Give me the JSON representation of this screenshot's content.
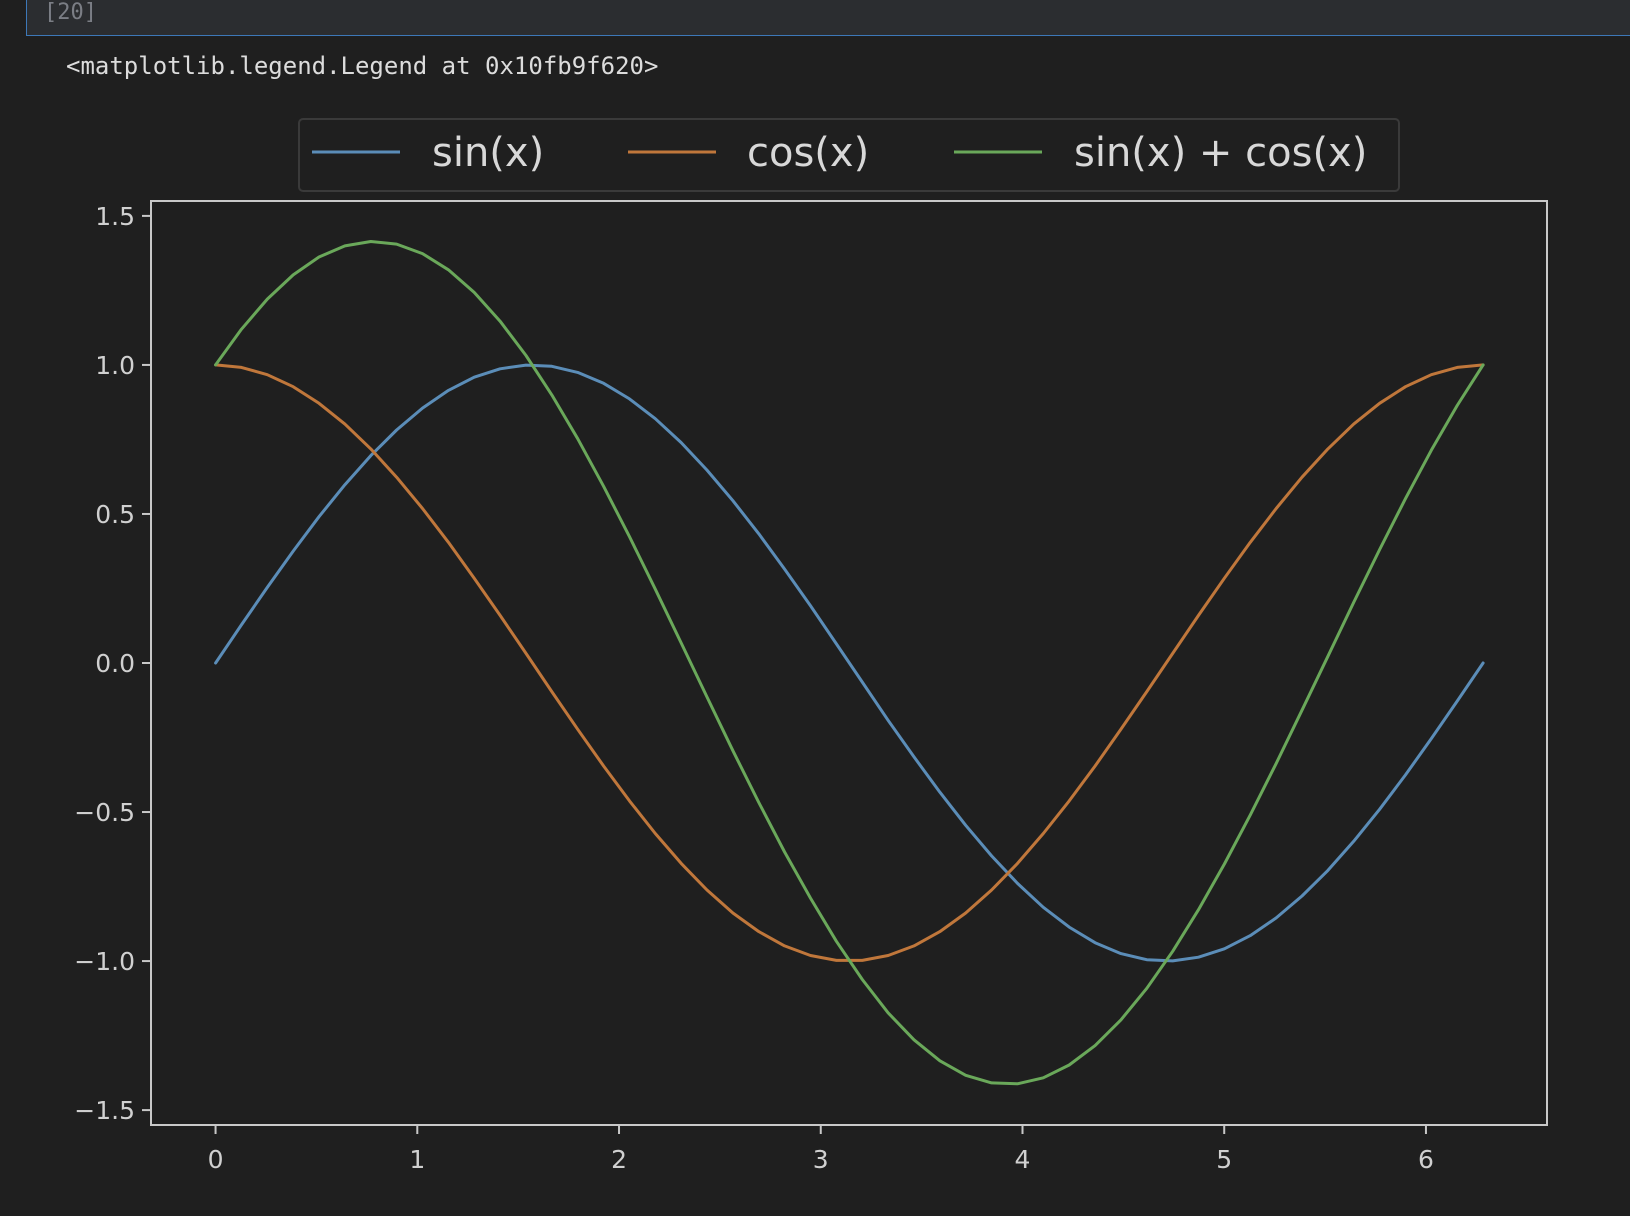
{
  "cell": {
    "execution_count": "[20]",
    "output_text": "<matplotlib.legend.Legend at 0x10fb9f620>"
  },
  "colors": {
    "background": "#1f1f1f",
    "axes_frame": "#c8c8c8",
    "tick_text": "#d0d0d0",
    "legend_border": "#3a3a3a",
    "cell_border": "#3d78b8"
  },
  "chart_data": {
    "type": "line",
    "title": "",
    "xlabel": "",
    "ylabel": "",
    "xlim": [
      -0.32,
      6.6
    ],
    "ylim": [
      -1.55,
      1.55
    ],
    "xticks": [
      0,
      1,
      2,
      3,
      4,
      5,
      6
    ],
    "xtick_labels": [
      "0",
      "1",
      "2",
      "3",
      "4",
      "5",
      "6"
    ],
    "yticks": [
      1.5,
      1.0,
      0.5,
      0.0,
      -0.5,
      -1.0,
      -1.5
    ],
    "ytick_labels": [
      "1.5",
      "1.0",
      "0.5",
      "0.0",
      "−0.5",
      "−1.0",
      "−1.5"
    ],
    "grid": false,
    "legend": {
      "placement": "top-center, above plot",
      "columns": 3
    },
    "x": [
      0.0,
      0.1282,
      0.2565,
      0.3847,
      0.5129,
      0.6411,
      0.7694,
      0.8976,
      1.0258,
      1.1541,
      1.2823,
      1.4105,
      1.5387,
      1.667,
      1.7952,
      1.9234,
      2.0517,
      2.1799,
      2.3081,
      2.4363,
      2.5646,
      2.6928,
      2.821,
      2.9493,
      3.0775,
      3.2057,
      3.3339,
      3.4622,
      3.5904,
      3.7186,
      3.8468,
      3.9751,
      4.1033,
      4.2315,
      4.3598,
      4.488,
      4.6162,
      4.7444,
      4.8727,
      5.0009,
      5.1291,
      5.2574,
      5.3856,
      5.5138,
      5.642,
      5.7703,
      5.8985,
      6.0267,
      6.155,
      6.2832
    ],
    "series": [
      {
        "name": "sin(x)",
        "color": "#5b8db8",
        "values": [
          0.0,
          0.1279,
          0.2537,
          0.3753,
          0.4907,
          0.5981,
          0.6957,
          0.7818,
          0.8551,
          0.9144,
          0.9587,
          0.9872,
          0.9995,
          0.9954,
          0.9749,
          0.9383,
          0.8862,
          0.8196,
          0.7395,
          0.6473,
          0.5446,
          0.4333,
          0.3151,
          0.1924,
          0.0641,
          -0.0641,
          -0.1924,
          -0.3151,
          -0.4333,
          -0.5446,
          -0.6473,
          -0.7395,
          -0.8196,
          -0.8862,
          -0.9383,
          -0.9749,
          -0.9954,
          -0.9995,
          -0.9872,
          -0.9587,
          -0.9144,
          -0.8551,
          -0.7818,
          -0.6957,
          -0.5981,
          -0.4907,
          -0.3753,
          -0.2537,
          -0.1279,
          0.0
        ]
      },
      {
        "name": "cos(x)",
        "color": "#c0773b",
        "values": [
          1.0,
          0.9918,
          0.9673,
          0.9269,
          0.8713,
          0.8014,
          0.7183,
          0.6235,
          0.5184,
          0.4048,
          0.2845,
          0.1596,
          0.0321,
          -0.096,
          -0.2225,
          -0.3454,
          -0.4625,
          -0.5721,
          -0.6723,
          -0.7615,
          -0.8387,
          -0.9013,
          -0.9491,
          -0.9813,
          -0.9979,
          -0.9979,
          -0.9813,
          -0.9491,
          -0.9013,
          -0.8387,
          -0.7615,
          -0.6723,
          -0.5721,
          -0.4625,
          -0.3454,
          -0.2225,
          -0.096,
          0.0321,
          0.1596,
          0.2845,
          0.4048,
          0.5184,
          0.6235,
          0.7183,
          0.8014,
          0.8713,
          0.9269,
          0.9673,
          0.9918,
          1.0
        ]
      },
      {
        "name": "sin(x) + cos(x)",
        "color": "#6aa85a",
        "values": [
          1.0,
          1.1197,
          1.221,
          1.3022,
          1.362,
          1.3995,
          1.414,
          1.4053,
          1.3735,
          1.3192,
          1.2432,
          1.1468,
          1.0316,
          0.8994,
          0.7524,
          0.5929,
          0.4237,
          0.2475,
          0.0672,
          -0.1142,
          -0.2941,
          -0.468,
          -0.634,
          -0.7889,
          -0.9338,
          -1.062,
          -1.1737,
          -1.2642,
          -1.3346,
          -1.3833,
          -1.4088,
          -1.4118,
          -1.3917,
          -1.3487,
          -1.2837,
          -1.1974,
          -1.0914,
          -0.9674,
          -0.8276,
          -0.6742,
          -0.5096,
          -0.3367,
          -0.1583,
          0.0226,
          0.2033,
          0.3806,
          0.5516,
          0.7136,
          0.8639,
          1.0
        ]
      }
    ]
  }
}
